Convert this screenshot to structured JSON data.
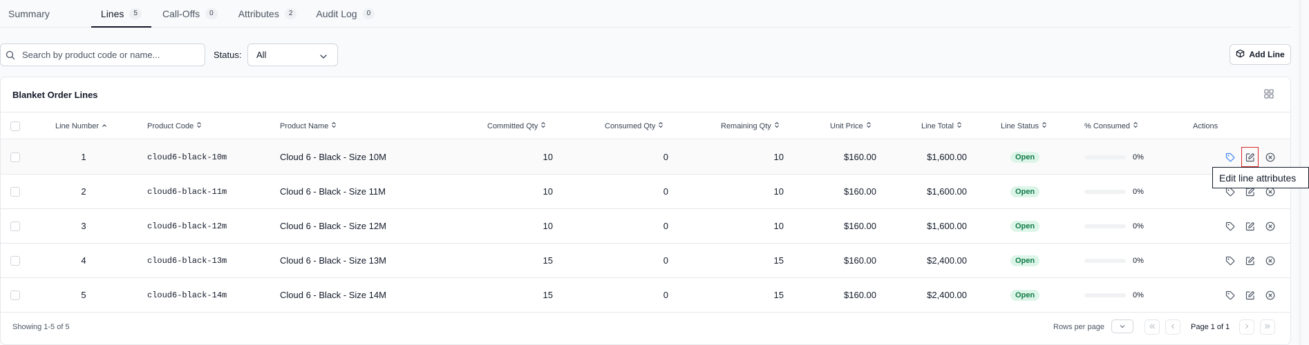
{
  "tabs": [
    {
      "label": "Summary",
      "count": null
    },
    {
      "label": "Lines",
      "count": "5"
    },
    {
      "label": "Call-Offs",
      "count": "0"
    },
    {
      "label": "Attributes",
      "count": "2"
    },
    {
      "label": "Audit Log",
      "count": "0"
    }
  ],
  "search": {
    "placeholder": "Search by product code or name...",
    "value": ""
  },
  "status_filter": {
    "label": "Status:",
    "value": "All"
  },
  "add_line_label": "Add Line",
  "card_title": "Blanket Order Lines",
  "columns": {
    "line_number": "Line Number",
    "product_code": "Product Code",
    "product_name": "Product Name",
    "committed_qty": "Committed Qty",
    "consumed_qty": "Consumed Qty",
    "remaining_qty": "Remaining Qty",
    "unit_price": "Unit Price",
    "line_total": "Line Total",
    "line_status": "Line Status",
    "pct_consumed": "% Consumed",
    "actions": "Actions"
  },
  "rows": [
    {
      "line": "1",
      "code": "cloud6-black-10m",
      "name": "Cloud 6 - Black - Size 10M",
      "committed": "10",
      "consumed": "0",
      "remaining": "10",
      "price": "$160.00",
      "total": "$1,600.00",
      "status": "Open",
      "pct": "0%",
      "pct_value": 0
    },
    {
      "line": "2",
      "code": "cloud6-black-11m",
      "name": "Cloud 6 - Black - Size 11M",
      "committed": "10",
      "consumed": "0",
      "remaining": "10",
      "price": "$160.00",
      "total": "$1,600.00",
      "status": "Open",
      "pct": "0%",
      "pct_value": 0
    },
    {
      "line": "3",
      "code": "cloud6-black-12m",
      "name": "Cloud 6 - Black - Size 12M",
      "committed": "10",
      "consumed": "0",
      "remaining": "10",
      "price": "$160.00",
      "total": "$1,600.00",
      "status": "Open",
      "pct": "0%",
      "pct_value": 0
    },
    {
      "line": "4",
      "code": "cloud6-black-13m",
      "name": "Cloud 6 - Black - Size 13M",
      "committed": "15",
      "consumed": "0",
      "remaining": "15",
      "price": "$160.00",
      "total": "$2,400.00",
      "status": "Open",
      "pct": "0%",
      "pct_value": 0
    },
    {
      "line": "5",
      "code": "cloud6-black-14m",
      "name": "Cloud 6 - Black - Size 14M",
      "committed": "15",
      "consumed": "0",
      "remaining": "15",
      "price": "$160.00",
      "total": "$2,400.00",
      "status": "Open",
      "pct": "0%",
      "pct_value": 0
    }
  ],
  "row_action_icons": [
    "tag-icon",
    "edit-icon",
    "cancel-circle-icon"
  ],
  "footer": {
    "showing": "Showing 1-5 of 5",
    "rows_per_page_label": "Rows per page",
    "page_info": "Page 1 of 1"
  },
  "tooltip": "Edit line attributes",
  "colors": {
    "accent": "#3b82f6",
    "open_badge_bg": "#dcf5e8",
    "open_badge_text": "#0f7a46",
    "highlight": "#dc2626"
  }
}
